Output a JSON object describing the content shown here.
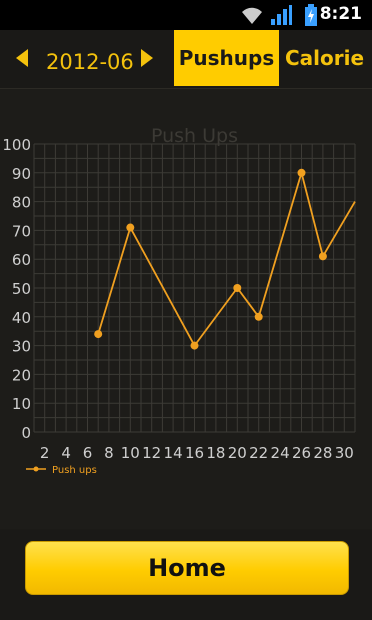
{
  "status_bar": {
    "time": "8:21",
    "icons": [
      "wifi-icon",
      "signal-icon",
      "battery-charging-icon"
    ]
  },
  "header": {
    "prev_icon": "chevron-left-icon",
    "next_icon": "chevron-right-icon",
    "month": "2012-06",
    "tabs": [
      {
        "label": "Pushups",
        "active": true
      },
      {
        "label": "Calorie",
        "active": false
      }
    ]
  },
  "colors": {
    "accent": "#ffcc00",
    "line": "#f0a020",
    "background": "#1b1a17"
  },
  "chart_data": {
    "type": "line",
    "title": "Push Ups",
    "xlabel": "",
    "ylabel": "",
    "xlim": [
      1,
      31
    ],
    "ylim": [
      0,
      100
    ],
    "x_ticks": [
      2,
      4,
      6,
      8,
      10,
      12,
      14,
      16,
      18,
      20,
      22,
      24,
      26,
      28,
      30
    ],
    "y_ticks": [
      0,
      10,
      20,
      30,
      40,
      50,
      60,
      70,
      80,
      90,
      100
    ],
    "grid": true,
    "legend": "bottom-left",
    "series": [
      {
        "name": "Push ups",
        "x": [
          7,
          10,
          16,
          20,
          22,
          26,
          28,
          31
        ],
        "y": [
          34,
          71,
          30,
          50,
          40,
          90,
          61,
          80
        ]
      }
    ]
  },
  "footer": {
    "home_label": "Home"
  }
}
